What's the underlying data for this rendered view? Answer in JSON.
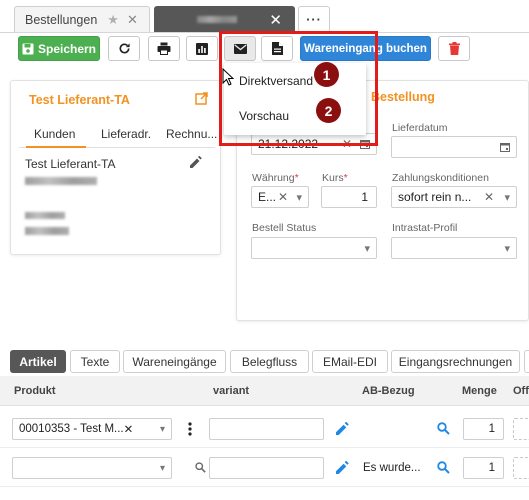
{
  "doc_tabs": {
    "tab1_label": "Bestellungen",
    "tab3_label": "···"
  },
  "toolbar": {
    "save_label": "Speichern",
    "wareneingang_label": "Wareneingang buchen"
  },
  "email_menu": {
    "items": [
      {
        "label": "Direktversand",
        "marker": "1"
      },
      {
        "label": "Vorschau",
        "marker": "2"
      }
    ]
  },
  "supplier_card": {
    "title": "Test Lieferant-TA",
    "tabs": [
      "Kunden",
      "Lieferadr.",
      "Rechnu..."
    ],
    "supplier_name": "Test Lieferant-TA"
  },
  "order_card": {
    "title": "Bestellung",
    "fields": {
      "bestelldatum_value": "21.12.2022",
      "lieferdatum_label": "Lieferdatum",
      "waehrung_label": "Währung",
      "waehrung_value": "E...",
      "kurs_label": "Kurs",
      "kurs_value": "1",
      "zahlungskonditionen_label": "Zahlungskonditionen",
      "zahlungskonditionen_value": "sofort rein n...",
      "bestell_status_label": "Bestell Status",
      "intrastat_label": "Intrastat-Profil"
    }
  },
  "bottom_tabs": [
    "Artikel",
    "Texte",
    "Wareneingänge",
    "Belegfluss",
    "EMail-EDI",
    "Eingangsrechnungen"
  ],
  "grid": {
    "headers": [
      "Produkt",
      "variant",
      "AB-Bezug",
      "Menge",
      "Offe"
    ],
    "rows": [
      {
        "produkt": "00010353 - Test M...",
        "ab_bezug": "",
        "menge": "1"
      },
      {
        "produkt": "",
        "ab_bezug": "Es wurde...",
        "menge": "1"
      }
    ]
  },
  "colors": {
    "accent_orange": "#f39221",
    "save_green": "#4caf50",
    "primary_blue": "#2f86d8",
    "danger_red": "#e53935",
    "highlight_red": "#e41b1b",
    "badge_darkred": "#8b0f0f",
    "link_blue": "#1e88e5"
  }
}
